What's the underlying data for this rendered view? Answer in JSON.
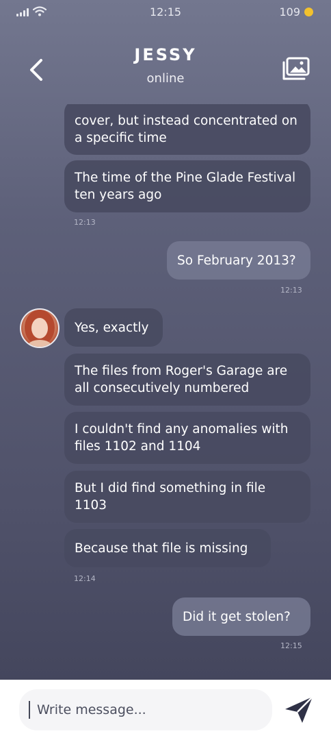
{
  "status_bar": {
    "time": "12:15",
    "battery": "109"
  },
  "header": {
    "title": "JESSY",
    "status": "online"
  },
  "messages": [
    {
      "text": "cover, but instead concentrated on a specific time",
      "direction": "incoming"
    },
    {
      "text": "The time of the Pine Glade Festival ten years ago",
      "direction": "incoming"
    },
    {
      "text": "So February 2013?",
      "direction": "outgoing"
    },
    {
      "text": "Yes, exactly",
      "direction": "incoming"
    },
    {
      "text": "The files from Roger's Garage are all consecutively numbered",
      "direction": "incoming"
    },
    {
      "text": "I couldn't find any anomalies with files 1102 and 1104",
      "direction": "incoming"
    },
    {
      "text": "But I did find something in file 1103",
      "direction": "incoming"
    },
    {
      "text": "Because that file is missing",
      "direction": "incoming"
    },
    {
      "text": "Did it get stolen?",
      "direction": "outgoing"
    }
  ],
  "timestamps": [
    "12:13",
    "12:13",
    "12:14",
    "12:15"
  ],
  "input": {
    "placeholder": "Write message..."
  },
  "colors": {
    "accent": "#2f3146",
    "coin": "#f2c12e"
  }
}
